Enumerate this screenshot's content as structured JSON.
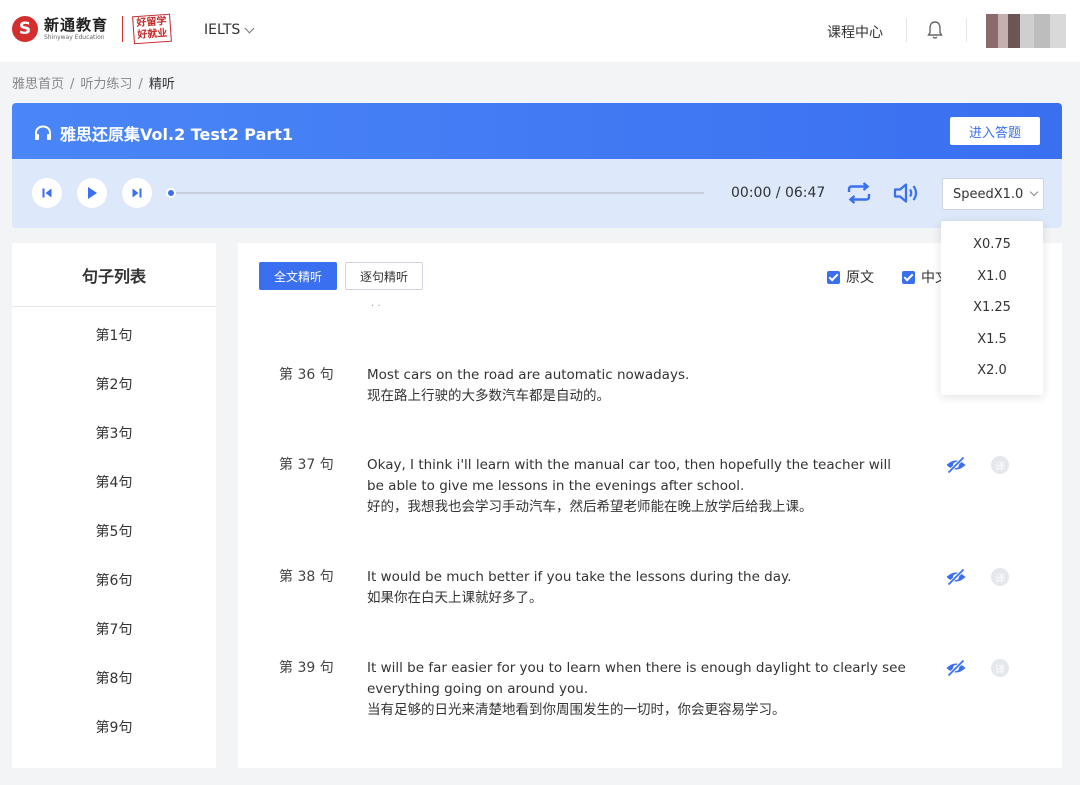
{
  "nav": {
    "logo_mark": "S",
    "logo_cn": "新通教育",
    "logo_en": "Shinyway Education",
    "badge_line1": "好留学",
    "badge_line2": "好就业",
    "course_label": "IELTS",
    "course_center": "课程中心"
  },
  "breadcrumb": {
    "home": "雅思首页",
    "sep": "/",
    "section": "听力练习",
    "current": "精听"
  },
  "header": {
    "title": "雅思还原集Vol.2 Test2 Part1",
    "enter_button": "进入答题"
  },
  "player": {
    "time": "00:00 / 06:47",
    "progress": 0,
    "speed_label": "SpeedX1.0"
  },
  "speed_options": [
    "X0.75",
    "X1.0",
    "X1.25",
    "X1.5",
    "X2.0"
  ],
  "sidebar": {
    "title": "句子列表",
    "items": [
      "第1句",
      "第2句",
      "第3句",
      "第4句",
      "第5句",
      "第6句",
      "第7句",
      "第8句",
      "第9句"
    ]
  },
  "main": {
    "mode_full": "全文精听",
    "mode_line": "逐句精听",
    "check_original": "原文",
    "check_chinese": "中文",
    "faint_text": ". .",
    "sentences": [
      {
        "num": "第 36 句",
        "en": "Most cars on the road are automatic nowadays.",
        "cn": "现在路上行驶的大多数汽车都是自动的。"
      },
      {
        "num": "第 37 句",
        "en": "Okay, I think i'll learn with the manual car too, then hopefully the teacher will be able to give me lessons in the evenings after school.",
        "cn": "好的，我想我也会学习手动汽车，然后希望老师能在晚上放学后给我上课。"
      },
      {
        "num": "第 38 句",
        "en": "It would be much better if you take the lessons during the day.",
        "cn": "如果你在白天上课就好多了。"
      },
      {
        "num": "第 39 句",
        "en": "It will be far easier for you to learn when there is enough daylight to clearly see everything going on around you.",
        "cn": "当有足够的日光来清楚地看到你周围发生的一切时，你会更容易学习。"
      }
    ],
    "trans_icon_text": "译"
  },
  "colors": {
    "accent": "#3a6ff0",
    "brand": "#d32f2f"
  }
}
